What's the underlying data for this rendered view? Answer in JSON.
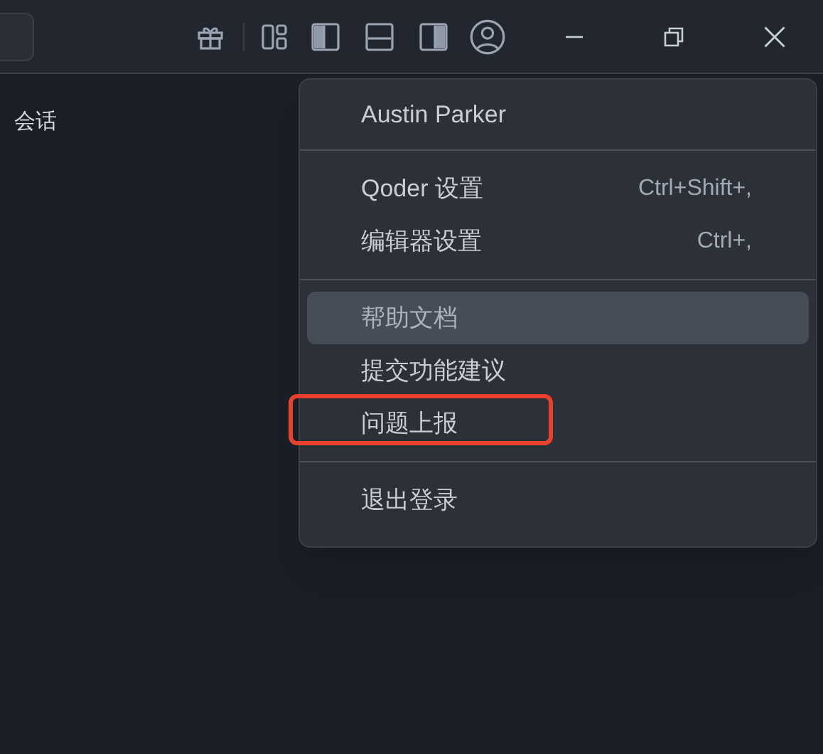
{
  "top_bar": {
    "layout_toggles": [
      {
        "kind": "left",
        "on": true
      },
      {
        "kind": "bottom",
        "on": false
      },
      {
        "kind": "right",
        "on": true
      }
    ]
  },
  "sidebar": {
    "title": "会话"
  },
  "account_menu": {
    "sections": [
      {
        "items": [
          {
            "label": "Austin Parker",
            "selected": false,
            "annotated": false
          }
        ]
      },
      {
        "items": [
          {
            "label": "Qoder 设置",
            "shortcut": "Ctrl+Shift+,",
            "selected": false,
            "annotated": false
          },
          {
            "label": "编辑器设置",
            "shortcut": "Ctrl+,",
            "selected": false,
            "annotated": false
          }
        ]
      },
      {
        "items": [
          {
            "label": "帮助文档",
            "selected": true,
            "annotated": false
          },
          {
            "label": "提交功能建议",
            "selected": false,
            "annotated": false
          },
          {
            "label": "问题上报",
            "selected": false,
            "annotated": true
          }
        ]
      },
      {
        "items": [
          {
            "label": "退出登录",
            "selected": false,
            "annotated": false
          }
        ]
      }
    ]
  }
}
